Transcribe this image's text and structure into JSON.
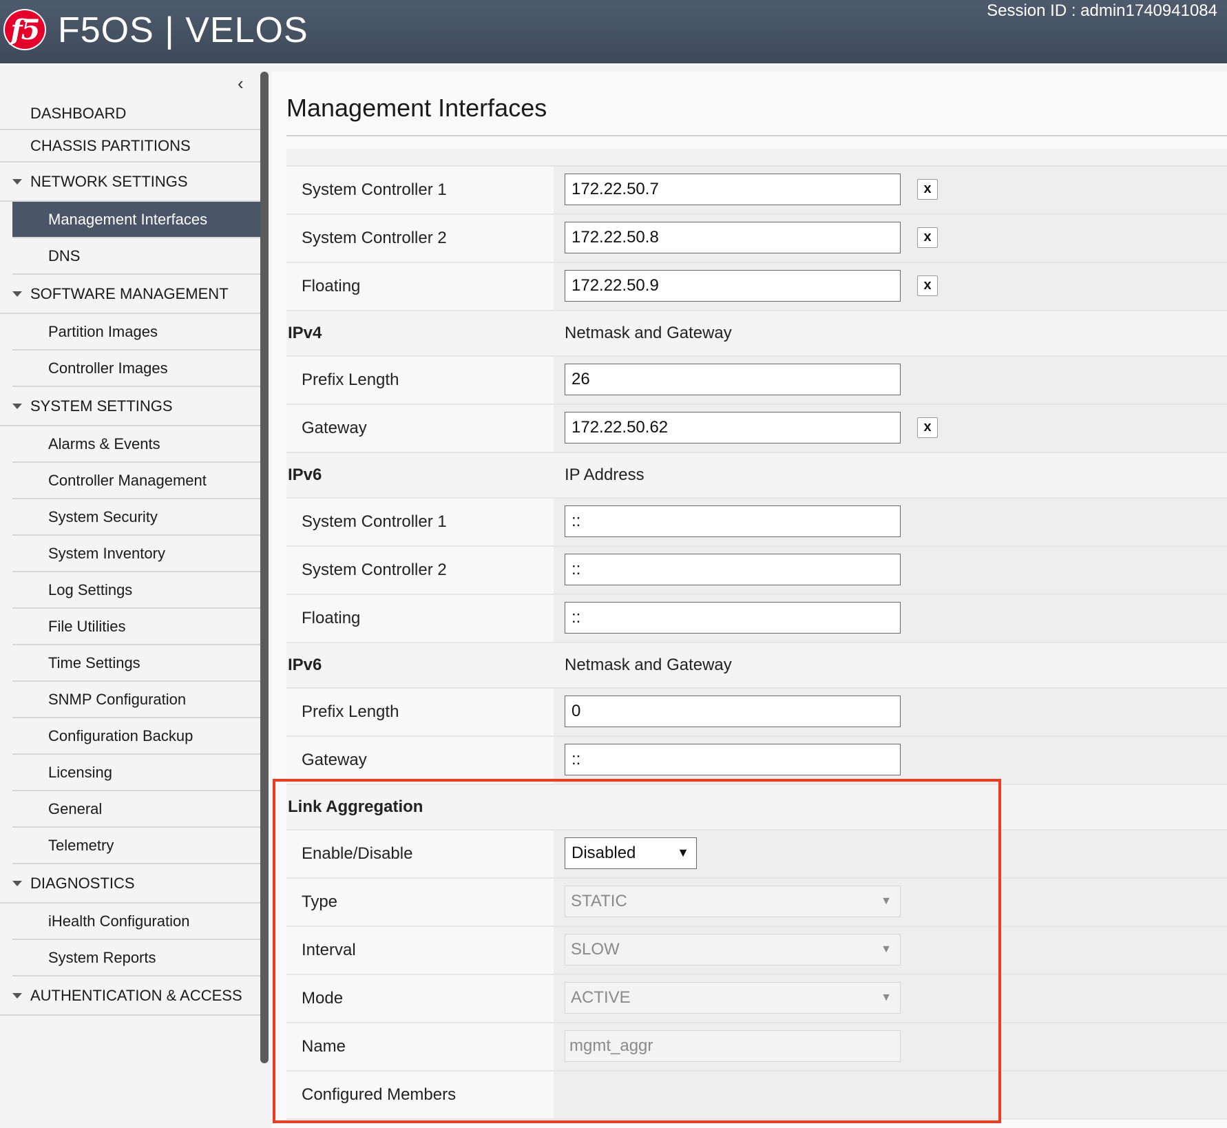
{
  "header": {
    "logo_text": "f5",
    "app_title": "F5OS | VELOS",
    "session": "Session ID : admin1740941084"
  },
  "sidebar": {
    "collapse_icon": "chevron-left-icon",
    "items": [
      {
        "label": "DASHBOARD",
        "level": "top"
      },
      {
        "label": "CHASSIS PARTITIONS",
        "level": "top"
      },
      {
        "label": "NETWORK SETTINGS",
        "level": "section"
      },
      {
        "label": "Management Interfaces",
        "level": "sub",
        "active": true
      },
      {
        "label": "DNS",
        "level": "sub"
      },
      {
        "label": "SOFTWARE MANAGEMENT",
        "level": "section"
      },
      {
        "label": "Partition Images",
        "level": "sub"
      },
      {
        "label": "Controller Images",
        "level": "sub"
      },
      {
        "label": "SYSTEM SETTINGS",
        "level": "section"
      },
      {
        "label": "Alarms & Events",
        "level": "sub"
      },
      {
        "label": "Controller Management",
        "level": "sub"
      },
      {
        "label": "System Security",
        "level": "sub"
      },
      {
        "label": "System Inventory",
        "level": "sub"
      },
      {
        "label": "Log Settings",
        "level": "sub"
      },
      {
        "label": "File Utilities",
        "level": "sub"
      },
      {
        "label": "Time Settings",
        "level": "sub"
      },
      {
        "label": "SNMP Configuration",
        "level": "sub"
      },
      {
        "label": "Configuration Backup",
        "level": "sub"
      },
      {
        "label": "Licensing",
        "level": "sub"
      },
      {
        "label": "General",
        "level": "sub"
      },
      {
        "label": "Telemetry",
        "level": "sub"
      },
      {
        "label": "DIAGNOSTICS",
        "level": "section"
      },
      {
        "label": "iHealth Configuration",
        "level": "sub"
      },
      {
        "label": "System Reports",
        "level": "sub"
      },
      {
        "label": "AUTHENTICATION & ACCESS",
        "level": "section"
      }
    ]
  },
  "main": {
    "title": "Management Interfaces",
    "ipv4_addresses": {
      "sc1_label": "System Controller 1",
      "sc1_value": "172.22.50.7",
      "sc2_label": "System Controller 2",
      "sc2_value": "172.22.50.8",
      "floating_label": "Floating",
      "floating_value": "172.22.50.9",
      "clear_label": "x"
    },
    "ipv4_netmask": {
      "heading": "IPv4",
      "subheading": "Netmask and Gateway",
      "prefix_label": "Prefix Length",
      "prefix_value": "26",
      "gateway_label": "Gateway",
      "gateway_value": "172.22.50.62"
    },
    "ipv6_addresses": {
      "heading": "IPv6",
      "subheading": "IP Address",
      "sc1_label": "System Controller 1",
      "sc1_value": "::",
      "sc2_label": "System Controller 2",
      "sc2_value": "::",
      "floating_label": "Floating",
      "floating_value": "::"
    },
    "ipv6_netmask": {
      "heading": "IPv6",
      "subheading": "Netmask and Gateway",
      "prefix_label": "Prefix Length",
      "prefix_value": "0",
      "gateway_label": "Gateway",
      "gateway_value": "::"
    },
    "link_aggregation": {
      "heading": "Link Aggregation",
      "enable_label": "Enable/Disable",
      "enable_value": "Disabled",
      "type_label": "Type",
      "type_value": "STATIC",
      "interval_label": "Interval",
      "interval_value": "SLOW",
      "mode_label": "Mode",
      "mode_value": "ACTIVE",
      "name_label": "Name",
      "name_value": "mgmt_aggr",
      "members_label": "Configured Members"
    },
    "highlight_color": "#f03a22"
  }
}
